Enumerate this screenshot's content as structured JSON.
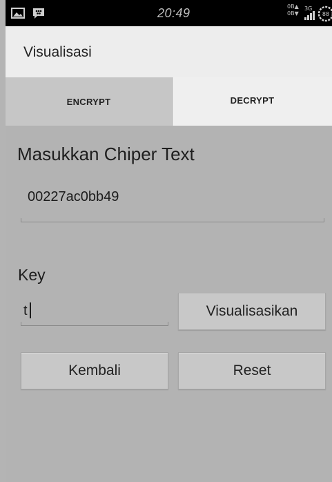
{
  "status_bar": {
    "time": "20:49",
    "data_up": "0B▲",
    "data_down": "0B▼",
    "network": "3G",
    "battery_level": "88",
    "icons": [
      "gallery-icon",
      "bbm-icon",
      "signal-icon",
      "battery-icon"
    ]
  },
  "action_bar": {
    "title": "Visualisasi"
  },
  "tabs": [
    {
      "label": "ENCRYPT",
      "selected": false
    },
    {
      "label": "DECRYPT",
      "selected": true
    }
  ],
  "form": {
    "heading": "Masukkan Chiper Text",
    "cipher_value": "00227ac0bb49",
    "key_label": "Key",
    "key_value": "t"
  },
  "buttons": {
    "visualize": "Visualisasikan",
    "back": "Kembali",
    "reset": "Reset"
  }
}
